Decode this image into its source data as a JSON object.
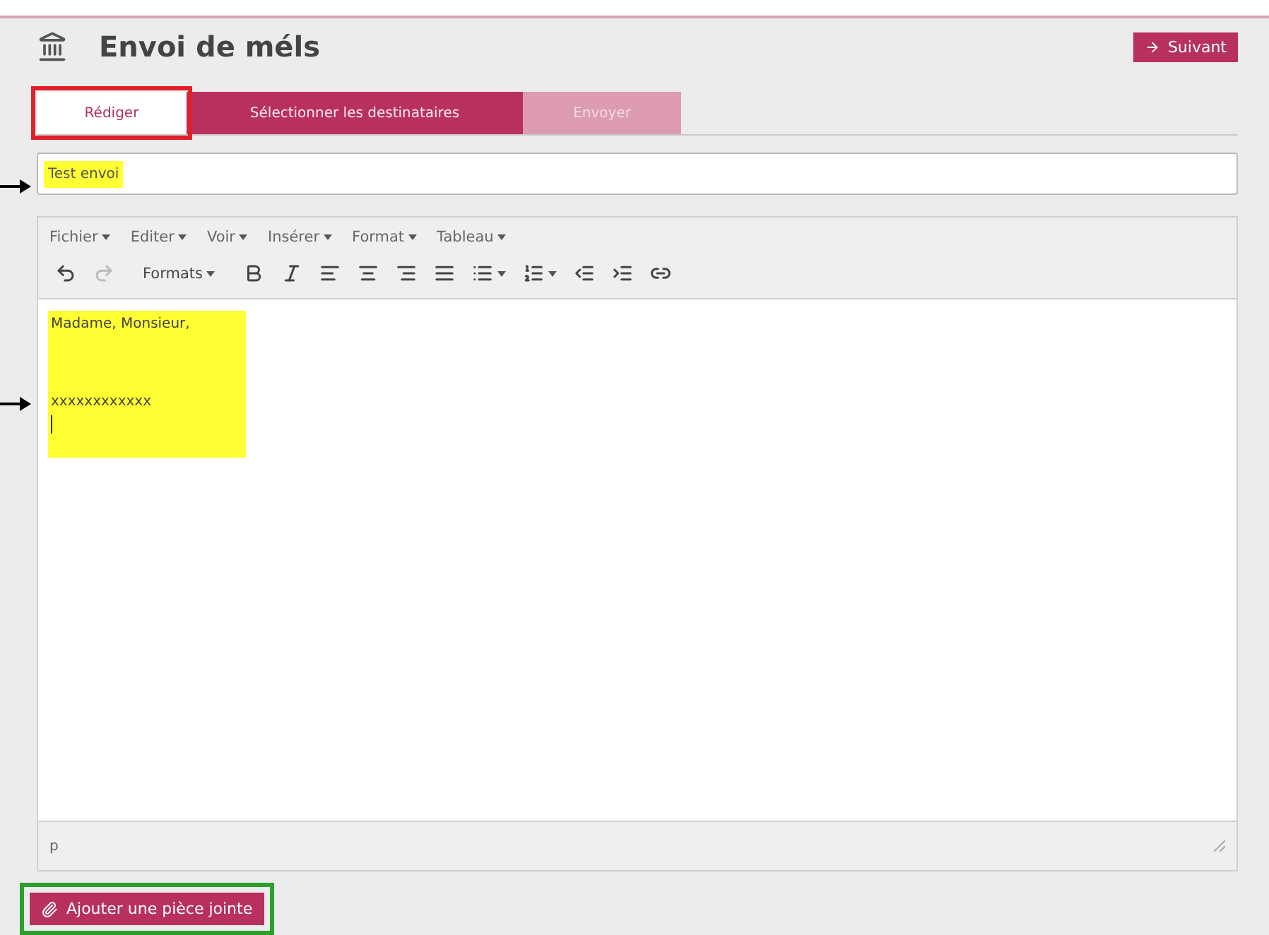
{
  "header": {
    "title": "Envoi de méls",
    "next_button": "Suivant"
  },
  "tabs": [
    {
      "label": "Rédiger",
      "selected": true,
      "disabled": false,
      "outlined": true
    },
    {
      "label": "Sélectionner les destinataires",
      "selected": false,
      "disabled": false
    },
    {
      "label": "Envoyer",
      "selected": false,
      "disabled": true
    }
  ],
  "subject": {
    "value": "Test envoi",
    "highlighted": true
  },
  "editor": {
    "menus": [
      "Fichier",
      "Editer",
      "Voir",
      "Insérer",
      "Format",
      "Tableau"
    ],
    "toolbar": [
      {
        "kind": "undo",
        "disabled": false
      },
      {
        "kind": "redo",
        "disabled": true
      },
      {
        "kind": "formats",
        "label": "Formats"
      },
      {
        "kind": "bold"
      },
      {
        "kind": "italic"
      },
      {
        "kind": "align-left"
      },
      {
        "kind": "align-center"
      },
      {
        "kind": "align-right"
      },
      {
        "kind": "justify"
      },
      {
        "kind": "bullet-list"
      },
      {
        "kind": "numbered-list"
      },
      {
        "kind": "outdent"
      },
      {
        "kind": "indent"
      },
      {
        "kind": "link"
      }
    ],
    "body": [
      "Madame, Monsieur,",
      "xxxxxxxxxxxx"
    ],
    "highlighted": true,
    "path": "p"
  },
  "attach_button": {
    "label": "Ajouter une pièce jointe",
    "outlined": true
  }
}
